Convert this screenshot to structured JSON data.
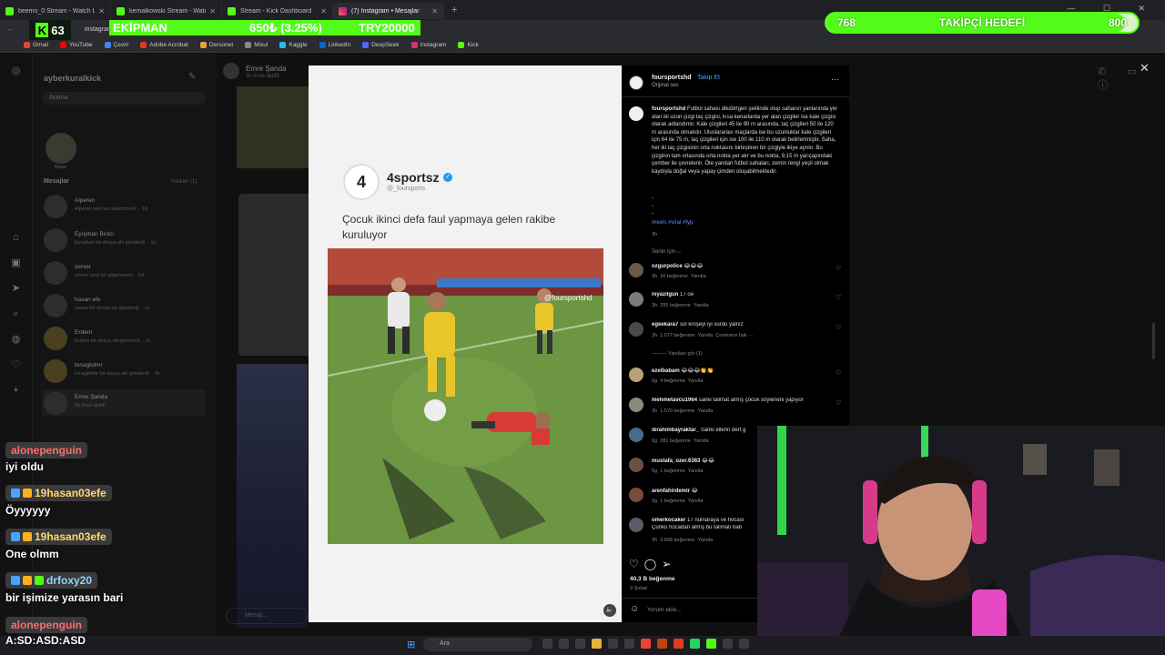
{
  "browser": {
    "tabs": [
      {
        "label": "beemo_0 Stream - Watch Live",
        "icon": "kick-icon",
        "active": false
      },
      {
        "label": "kemalkowski Stream - Watch L",
        "icon": "kick-icon",
        "active": false
      },
      {
        "label": "Stream - Kick Dashboard",
        "icon": "kick-icon",
        "active": false
      },
      {
        "label": "(7) Instagram • Mesajlar",
        "icon": "instagram-icon",
        "active": true
      }
    ],
    "new_tab": "+",
    "url": "instagram.com",
    "bookmarks": [
      "Gmail",
      "YouTube",
      "Çeviri",
      "Adobe Acrobat",
      "Dersonet",
      "Mixul",
      "Kaggle",
      "LinkedIn",
      "DeepSeek",
      "Instagram",
      "Kick"
    ]
  },
  "overlay": {
    "kick_count": "63",
    "ticker": [
      "EKİPMAN",
      "650₺ (3.25%)",
      "TRY20000"
    ],
    "follow_goal": {
      "current": "768",
      "label": "TAKİPÇİ HEDEFİ",
      "target": "800",
      "progress": 0.96
    },
    "accent": "#53fc18"
  },
  "instagram": {
    "username": "ayberkuralkick",
    "search_placeholder": "Arama",
    "note_label": "Notun",
    "messages_header": "Mesajlar",
    "requests": "İstekler (1)",
    "conversations": [
      {
        "name": "Alperen",
        "preview": "Alperen sent an attachment. · 1d"
      },
      {
        "name": "Eyüphan Binici",
        "preview": "Eyüphan bir dosya eki gönderdi. · 1s"
      },
      {
        "name": "server",
        "preview": "server sent an attachment. · 5d"
      },
      {
        "name": "hasan efe",
        "preview": "hasan bir dosya eki gönderdi. · 1s"
      },
      {
        "name": "Erdem",
        "preview": "Erdem bir dosya eki gönderdi. · 2s"
      },
      {
        "name": "tunagkdmr",
        "preview": "tunagkdmr bir dosya eki gönderdi. · 3s"
      },
      {
        "name": "Emre Şanda",
        "preview": "3s önce aktifti"
      }
    ],
    "chat_header_name": "Emre Şanda",
    "chat_header_status": "3s önce aktifti",
    "chat_input_placeholder": "Mesaj..."
  },
  "post": {
    "account": "4sportsz",
    "handle": "@_foursports",
    "caption": "Çocuk ikinci defa faul yapmaya gelen rakibe kuruluyor",
    "watermark": "@foursportshd"
  },
  "comments_panel": {
    "author": "foursportshd",
    "follow": "Takip Et",
    "audio": "Orijinal ses",
    "caption": "Futbol sahası dikdörtgen şeklinde olup sahanın yanlarında yer alan iki uzun çizgi taç çizgisi, kısa kenarlarda yer alan çizgiler ise kale çizgisi olarak adlandırılır. Kale çizgileri 45 ile 90 m arasında, taç çizgileri 50 ile 120 m arasında olmalıdır. Uluslararası maçlarda ise bu uzunluklar kale çizgileri için 64 ile 75 m, taç çizgileri için ise 100 ile 110 m olarak belirlenmiştir. Saha, her iki taç çizgisinin orta noktasını birleştiren bir çizgiyle ikiye ayrılır. Bu çizginin tam ortasında orta nokta yer alır ve bu nokta, 9,15 m yarıçapındaki çember ile çevrelenir. Öte yandan futbol sahaları, zemin rengi yeşil olmak kaydıyla doğal veya yapay çimden oluşabilmektedir.",
    "dashes": "-\n-\n-",
    "hashtags": "#reels #viral #fyp",
    "caption_time": "3h",
    "for_you": "Senin için ⌵",
    "comments": [
      {
        "user": "ozgurpolice",
        "text": "😂😂😂",
        "time": "3h",
        "likes": "16 beğenme",
        "reply": "Yanıtla"
      },
      {
        "user": "niyazilgun",
        "text": "17 oe",
        "time": "3h",
        "likes": "255 beğenme",
        "reply": "Yanıtla"
      },
      {
        "user": "egeekara7",
        "text": "sol kroşeyi iyi vurdu yalnız",
        "time": "3h",
        "likes": "1.077 beğenme",
        "reply": "Yanıtla",
        "extra": "Çevirisine bak ···"
      },
      {
        "user": "ezelbabam",
        "text": "😂😂😂👏👏",
        "time": "6g",
        "likes": "4 beğenme",
        "reply": "Yanıtla"
      },
      {
        "user": "mehmetavcu1964",
        "text": "sanki talimat almış çocuk söyleneni yapıyor",
        "time": "3h",
        "likes": "1.570 beğenme",
        "reply": "Yanıtla"
      },
      {
        "user": "ibrahimbayraktar_",
        "text": "Sanki ellerin dert g",
        "time": "6g",
        "likes": "281 beğenme",
        "reply": "Yanıtla"
      },
      {
        "user": "mustafa_ozer.6363",
        "text": "😂😂",
        "time": "5g",
        "likes": "1 beğenme",
        "reply": "Yanıtla"
      },
      {
        "user": "arenfahirdemir",
        "text": "😂",
        "time": "3g",
        "likes": "1 beğenme",
        "reply": "Yanıtla"
      },
      {
        "user": "omerkocaker",
        "text": "17 numaraya ve hocası",
        "text2": "Çünkü hocadan almış bu talimatı bab",
        "time": "3h",
        "likes": "3.608 beğenme",
        "reply": "Yanıtla"
      }
    ],
    "view_replies": "——— Yanıtları gör (1)",
    "likes": "40,3 B beğenme",
    "date": "9 Şubat",
    "comment_placeholder": "Yorum ekle..."
  },
  "stream_chat": [
    {
      "user": "alonepenguin",
      "message": "iyi oldu",
      "color": "#ff6b6b"
    },
    {
      "user": "19hasan03efe",
      "message": "Öyyyyyy",
      "color": "#ffd966"
    },
    {
      "user": "19hasan03efe",
      "message": "One olmm",
      "color": "#ffd966"
    },
    {
      "user": "drfoxy20",
      "message": "bir işimize yarasın bari",
      "color": "#8fd3ff"
    },
    {
      "user": "alonepenguin",
      "message": "A:SD:ASD:ASD",
      "color": "#ff6b6b"
    }
  ],
  "taskbar": {
    "search_placeholder": "Ara"
  }
}
